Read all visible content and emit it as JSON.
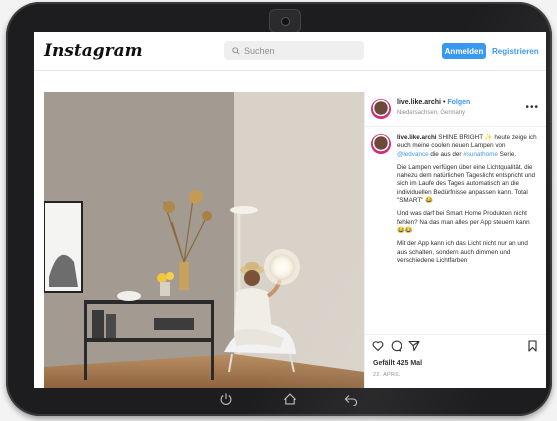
{
  "app": {
    "logo": "Instagram"
  },
  "search": {
    "placeholder": "Suchen"
  },
  "auth": {
    "login_label": "Anmelden",
    "register_label": "Registrieren"
  },
  "post": {
    "username": "live.like.archi",
    "follow_label": "Folgen",
    "separator": "•",
    "location": "Niedersachsen, Germany",
    "caption": {
      "username": "live.like.archi",
      "p1_text": " SHINE BRIGHT ✨ heute zeige ich euch meine coolen neuen Lampen von ",
      "p1_mention": "@ledvance",
      "p1_mid": " die aus der ",
      "p1_hashtag": "#sunathome",
      "p1_end": " Serie.",
      "p2": "Die Lampen verfügen über eine Lichtqualität, die nahezu dem natürlichen Tageslicht entspricht und sich im Laufe des Tages automatisch an die individuellen Bedürfnisse anpassen kann. Total \"SMART\" 😂",
      "p3": "Und was darf bei Smart Home Produkten nicht fehlen? Na das man alles per App steuern kann 😂😂",
      "p4": "Mit der App kann ich das Licht nicht nur an und aus schalten, sondern auch dimmen und verschiedene Lichtfarben"
    },
    "likes": "Gefällt 425 Mal",
    "date": "22. APRIL"
  },
  "icons": {
    "search": "search-icon",
    "like": "heart-icon",
    "comment": "comment-icon",
    "share": "paper-plane-icon",
    "save": "bookmark-icon",
    "more": "more-options-icon"
  },
  "colors": {
    "accent": "#3897f0",
    "text": "#262626",
    "muted": "#8e8e8e"
  },
  "device_nav": {
    "power": "power-icon",
    "home": "home-icon",
    "back": "back-icon"
  }
}
